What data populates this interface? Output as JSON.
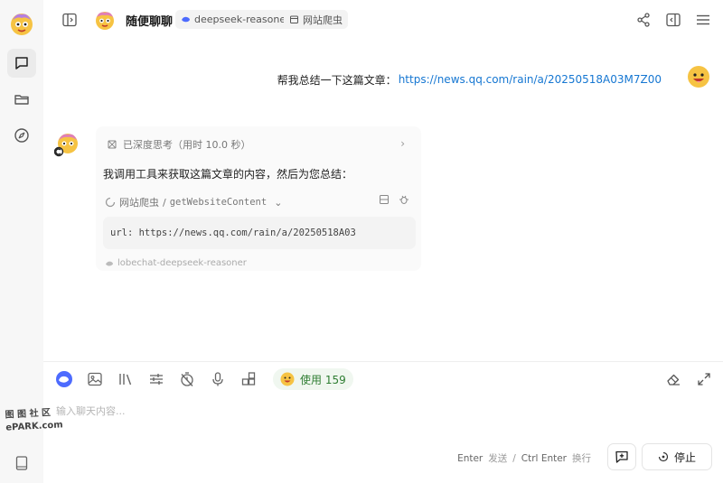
{
  "header": {
    "agent_name": "随便聊聊",
    "model_tag": "deepseek-reasoner",
    "plugin_tag": "网站爬虫"
  },
  "chat": {
    "user_message": {
      "prefix": "帮我总结一下这篇文章：",
      "link": "https://news.qq.com/rain/a/20250518A03M7Z00"
    },
    "assistant": {
      "thinking_label": "已深度思考（用时 10.0 秒）",
      "text": "我调用工具来获取这篇文章的内容，然后为您总结：",
      "tool_plugin": "网站爬虫",
      "tool_separator": "/",
      "tool_api": "getWebsiteContent",
      "tool_args": "url: https://news.qq.com/rain/a/20250518A03",
      "model_footer": "lobechat-deepseek-reasoner"
    }
  },
  "input": {
    "usage_label": "使用 159",
    "placeholder": "输入聊天内容...",
    "hint_enter": "Enter",
    "hint_send": "发送",
    "hint_sep": "/",
    "hint_ctrl_enter": "Ctrl Enter",
    "hint_newline": "换行",
    "stop_label": "停止"
  },
  "watermark": {
    "line1": "图 图 社 区",
    "line2": "ePARK.com"
  },
  "colors": {
    "link": "#1677d2",
    "accent_blue": "#1677ff",
    "rail_bg": "#f7f7f7",
    "usage_green": "#2e7d32"
  }
}
